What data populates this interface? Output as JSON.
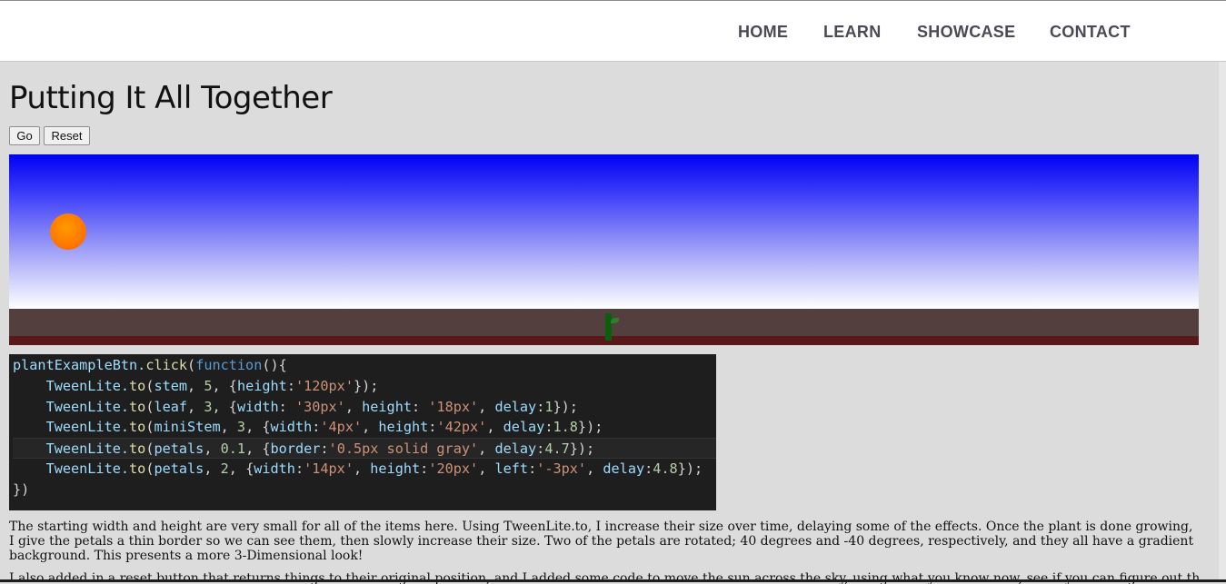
{
  "nav": {
    "home": "HOME",
    "learn": "LEARN",
    "showcase": "SHOWCASE",
    "contact": "CONTACT"
  },
  "page": {
    "title": "Putting It All Together"
  },
  "controls": {
    "go_label": "Go",
    "reset_label": "Reset"
  },
  "scene": {
    "sky_color_top": "#0000f5",
    "sky_color_bottom": "#ffffff",
    "ground_color": "#533f3d",
    "sun_color": "#ff7a00",
    "plant_color": "#0b5e0b"
  },
  "code": {
    "lines": [
      [
        [
          "plantExampleBtn.",
          "var"
        ],
        [
          "click",
          "fn"
        ],
        [
          "(",
          "p"
        ],
        [
          "function",
          "kw"
        ],
        [
          "(){",
          "p"
        ]
      ],
      [
        [
          "    TweenLite.",
          "var"
        ],
        [
          "to",
          "fn"
        ],
        [
          "(",
          "p"
        ],
        [
          "stem",
          "var"
        ],
        [
          ", ",
          "p"
        ],
        [
          "5",
          "num"
        ],
        [
          ", {",
          "p"
        ],
        [
          "height",
          "var"
        ],
        [
          ":",
          "p"
        ],
        [
          "'120px'",
          "str"
        ],
        [
          "});",
          "p"
        ]
      ],
      [
        [
          "    TweenLite.",
          "var"
        ],
        [
          "to",
          "fn"
        ],
        [
          "(",
          "p"
        ],
        [
          "leaf",
          "var"
        ],
        [
          ", ",
          "p"
        ],
        [
          "3",
          "num"
        ],
        [
          ", {",
          "p"
        ],
        [
          "width",
          "var"
        ],
        [
          ": ",
          "p"
        ],
        [
          "'30px'",
          "str"
        ],
        [
          ", ",
          "p"
        ],
        [
          "height",
          "var"
        ],
        [
          ": ",
          "p"
        ],
        [
          "'18px'",
          "str"
        ],
        [
          ", ",
          "p"
        ],
        [
          "delay",
          "var"
        ],
        [
          ":",
          "p"
        ],
        [
          "1",
          "num"
        ],
        [
          "});",
          "p"
        ]
      ],
      [
        [
          "    TweenLite.",
          "var"
        ],
        [
          "to",
          "fn"
        ],
        [
          "(",
          "p"
        ],
        [
          "miniStem",
          "var"
        ],
        [
          ", ",
          "p"
        ],
        [
          "3",
          "num"
        ],
        [
          ", {",
          "p"
        ],
        [
          "width",
          "var"
        ],
        [
          ":",
          "p"
        ],
        [
          "'4px'",
          "str"
        ],
        [
          ", ",
          "p"
        ],
        [
          "height",
          "var"
        ],
        [
          ":",
          "p"
        ],
        [
          "'42px'",
          "str"
        ],
        [
          ", ",
          "p"
        ],
        [
          "delay",
          "var"
        ],
        [
          ":",
          "p"
        ],
        [
          "1.8",
          "num"
        ],
        [
          "});",
          "p"
        ]
      ],
      [
        [
          "    TweenLite.",
          "var"
        ],
        [
          "to",
          "fn"
        ],
        [
          "(",
          "p"
        ],
        [
          "petals",
          "var"
        ],
        [
          ", ",
          "p"
        ],
        [
          "0.1",
          "num"
        ],
        [
          ", {",
          "p"
        ],
        [
          "border",
          "var"
        ],
        [
          ":",
          "p"
        ],
        [
          "'0.5px solid gray'",
          "str"
        ],
        [
          ", ",
          "p"
        ],
        [
          "delay",
          "var"
        ],
        [
          ":",
          "p"
        ],
        [
          "4.7",
          "num"
        ],
        [
          "});",
          "p"
        ]
      ],
      [
        [
          "    TweenLite.",
          "var"
        ],
        [
          "to",
          "fn"
        ],
        [
          "(",
          "p"
        ],
        [
          "petals",
          "var"
        ],
        [
          ", ",
          "p"
        ],
        [
          "2",
          "num"
        ],
        [
          ", {",
          "p"
        ],
        [
          "width",
          "var"
        ],
        [
          ":",
          "p"
        ],
        [
          "'14px'",
          "str"
        ],
        [
          ", ",
          "p"
        ],
        [
          "height",
          "var"
        ],
        [
          ":",
          "p"
        ],
        [
          "'20px'",
          "str"
        ],
        [
          ", ",
          "p"
        ],
        [
          "left",
          "var"
        ],
        [
          ":",
          "p"
        ],
        [
          "'-3px'",
          "str"
        ],
        [
          ", ",
          "p"
        ],
        [
          "delay",
          "var"
        ],
        [
          ":",
          "p"
        ],
        [
          "4.8",
          "num"
        ],
        [
          "});",
          "p"
        ]
      ],
      [
        [
          "})",
          "p"
        ]
      ]
    ]
  },
  "text": {
    "paragraph1": "The starting width and height are very small for all of the items here. Using TweenLite.to, I increase their size over time, delaying some of the effects. Once the plant is done growing, I give the petals a thin border so we can see them, then slowly increase their size. Two of the petals are rotated; 40 degrees and -40 degrees, respectively, and they all have a gradient background. This presents a more 3-Dimensional look!",
    "paragraph2": "I also added in a reset button that returns things to their original position, and I added some code to move the sun across the sky, using what you know now, see if you can figure out the code for"
  }
}
